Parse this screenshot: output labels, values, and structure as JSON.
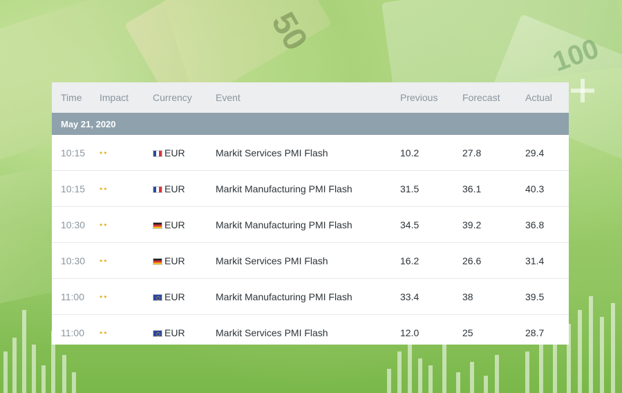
{
  "table": {
    "headers": {
      "time": "Time",
      "impact": "Impact",
      "currency": "Currency",
      "event": "Event",
      "previous": "Previous",
      "forecast": "Forecast",
      "actual": "Actual"
    },
    "date": "May 21, 2020",
    "rows": [
      {
        "time": "10:15",
        "impact": "••",
        "flag": "france-flag-icon",
        "currency": "EUR",
        "event": "Markit Services PMI Flash",
        "previous": "10.2",
        "forecast": "27.8",
        "actual": "29.4"
      },
      {
        "time": "10:15",
        "impact": "••",
        "flag": "france-flag-icon",
        "currency": "EUR",
        "event": "Markit Manufacturing PMI Flash",
        "previous": "31.5",
        "forecast": "36.1",
        "actual": "40.3"
      },
      {
        "time": "10:30",
        "impact": "••",
        "flag": "germany-flag-icon",
        "currency": "EUR",
        "event": "Markit Manufacturing PMI Flash",
        "previous": "34.5",
        "forecast": "39.2",
        "actual": "36.8"
      },
      {
        "time": "10:30",
        "impact": "••",
        "flag": "germany-flag-icon",
        "currency": "EUR",
        "event": "Markit Services PMI Flash",
        "previous": "16.2",
        "forecast": "26.6",
        "actual": "31.4"
      },
      {
        "time": "11:00",
        "impact": "••",
        "flag": "eu-flag-icon",
        "currency": "EUR",
        "event": "Markit Manufacturing PMI Flash",
        "previous": "33.4",
        "forecast": "38",
        "actual": "39.5"
      },
      {
        "time": "11:00",
        "impact": "••",
        "flag": "eu-flag-icon",
        "currency": "EUR",
        "event": "Markit Services PMI Flash",
        "previous": "12.0",
        "forecast": "25",
        "actual": "28.7"
      }
    ]
  },
  "colors": {
    "header_bg": "#eceeef",
    "date_bar_bg": "#8fa1ac",
    "impact_dot": "#e4b62a",
    "background_green": "#8cc265"
  }
}
